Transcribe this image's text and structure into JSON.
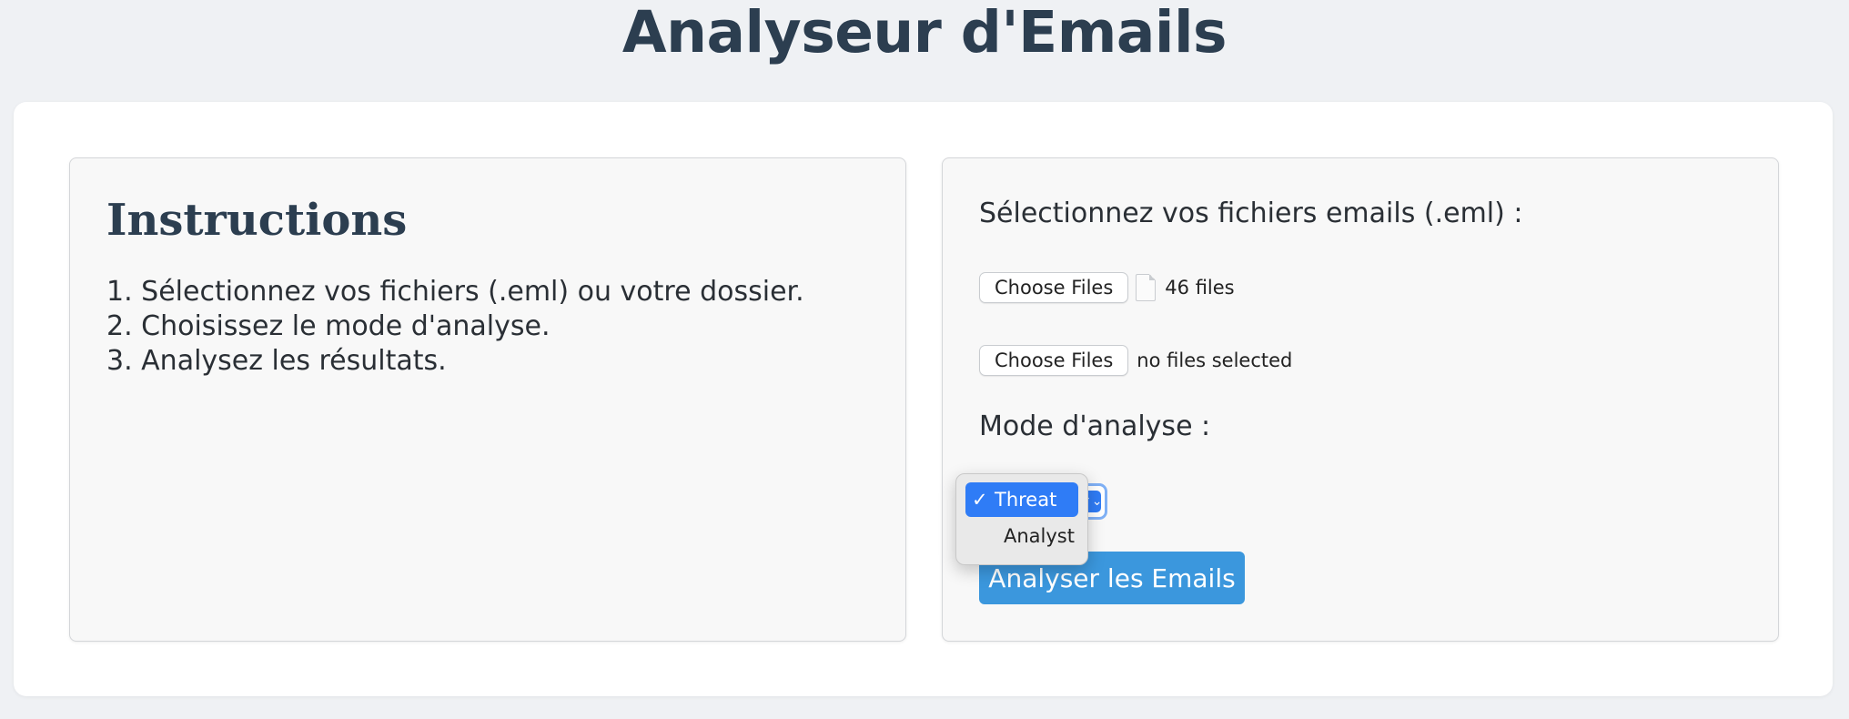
{
  "page": {
    "title": "Analyseur d'Emails"
  },
  "instructions": {
    "title": "Instructions",
    "steps": [
      "1. Sélectionnez vos fichiers (.eml) ou votre dossier.",
      "2. Choisissez le mode d'analyse.",
      "3. Analysez les résultats."
    ]
  },
  "form": {
    "files_label": "Sélectionnez vos fichiers emails (.eml) :",
    "file_inputs": [
      {
        "button_label": "Choose Files",
        "status": "46 files",
        "icon": "file-icon"
      },
      {
        "button_label": "Choose Files",
        "status": "no files selected"
      }
    ],
    "mode_label": "Mode d'analyse :",
    "mode_select": {
      "selected": "Threat",
      "options": [
        "Threat",
        "Analyst"
      ],
      "open": true,
      "check_glyph": "✓",
      "arrows_glyph": "⌃⌄"
    },
    "submit_label": "Analyser les Emails"
  },
  "colors": {
    "background": "#eff1f4",
    "title": "#2c3e50",
    "button_accent": "#3b97dd",
    "select_highlight": "#2f7cf6"
  }
}
